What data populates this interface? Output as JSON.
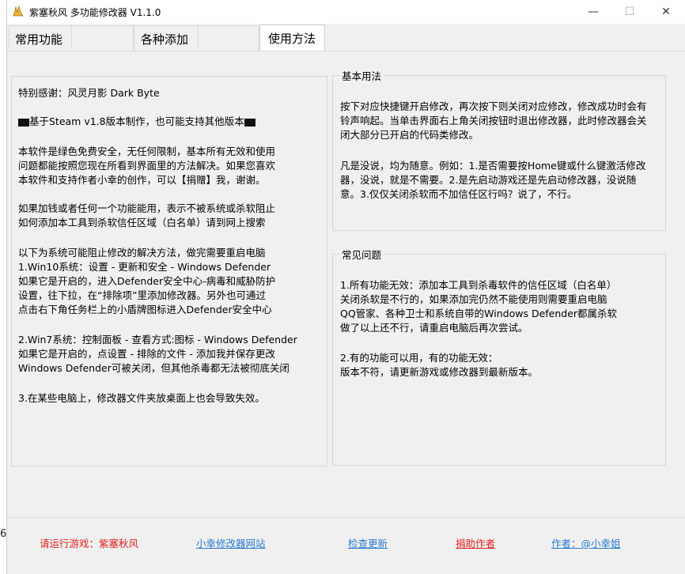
{
  "window": {
    "title": "紫塞秋风 多功能修改器  V1.1.0",
    "minimize_glyph": "—",
    "maximize_glyph": "☐",
    "close_glyph": "✕",
    "icon": "app-logo-icon"
  },
  "tabs": [
    {
      "label": "常用功能"
    },
    {
      "label": "各种添加"
    },
    {
      "label": "使用方法"
    }
  ],
  "thanks_panel": {
    "lines": [
      "特别感谢：风灵月影 Dark Byte",
      "基于Steam v1.8版本制作，也可能支持其他版本",
      "本软件是绿色免费安全，无任何限制，基本所有无效和使用",
      "问题都能按照您现在所看到界面里的方法解决。如果您喜欢",
      "本软件和支持作者小幸的创作，可以【捐赠】我，谢谢。",
      "如果加钱或者任何一个功能能用，表示不被系统或杀软阻止",
      "如何添加本工具到杀软信任区域（白名单）请到网上搜索",
      "以下为系统可能阻止修改的解决方法，做完需要重启电脑",
      "1.Win10系统：设置 - 更新和安全 - Windows Defender",
      "  如果它是开启的，进入Defender安全中心-病毒和威胁防护",
      "  设置，往下拉，在“排除项”里添加修改器。另外也可通过",
      "  点击右下角任务栏上的小盾牌图标进入Defender安全中心",
      "2.Win7系统：控制面板 - 查看方式:图标 - Windows Defender",
      "  如果它是开启的，点设置 - 排除的文件 - 添加我并保存更改",
      "  Windows Defender可被关闭，但其他杀毒都无法被彻底关闭",
      "3.在某些电脑上，修改器文件夹放桌面上也会导致失效。"
    ]
  },
  "basic_usage": {
    "title": "基本用法",
    "lines": [
      "按下对应快捷键开启修改，再次按下则关闭对应修改，修改成功时会有",
      "铃声响起。当单击界面右上角关闭按钮时退出修改器，此时修改器会关",
      "闭大部分已开启的代码类修改。",
      "凡是没说，均为随意。例如：1.是否需要按Home键或什么键激活修改",
      "器，没说，就是不需要。2.是先启动游戏还是先启动修改器，没说随",
      "意。3.仅仅关闭杀软而不加信任区行吗？说了，不行。"
    ]
  },
  "faq": {
    "title": "常见问题",
    "lines": [
      "1.所有功能无效：添加本工具到杀毒软件的信任区域（白名单）",
      "  关闭杀软是不行的，如果添加完仍然不能使用则需要重启电脑",
      "  QQ管家、各种卫士和系统自带的Windows Defender都属杀软",
      "  做了以上还不行，请重启电脑后再次尝试。",
      "2.有的功能可以用，有的功能无效：",
      "  版本不符，请更新游戏或修改器到最新版本。"
    ]
  },
  "footer": {
    "game_status": "请运行游戏：紫塞秋风",
    "site_link": "小幸修改器网站",
    "update_link": "检查更新",
    "donate_link": "捐助作者",
    "author_link": "作者：@小幸姐"
  },
  "background_text": "6"
}
